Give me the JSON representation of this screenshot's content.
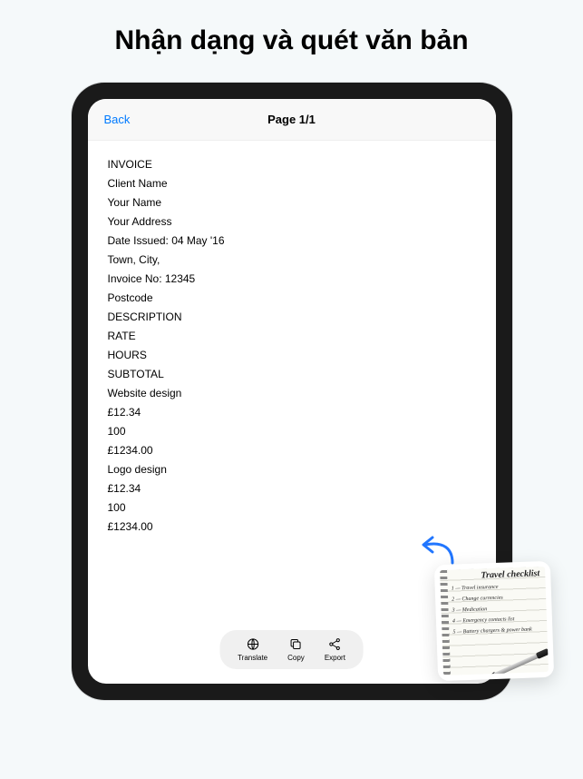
{
  "headline": "Nhận dạng và quét văn bản",
  "nav": {
    "back": "Back",
    "title": "Page 1/1"
  },
  "lines": [
    "INVOICE",
    "Client Name",
    "Your Name",
    "Your Address",
    "Date Issued: 04 May '16",
    "Town, City,",
    "Invoice No: 12345",
    "Postcode",
    "DESCRIPTION",
    "RATE",
    "HOURS",
    "SUBTOTAL",
    "Website design",
    "£12.34",
    "100",
    "£1234.00",
    "Logo design",
    "£12.34",
    "100",
    "£1234.00"
  ],
  "toolbar": {
    "translate": "Translate",
    "copy": "Copy",
    "export": "Export"
  },
  "note": {
    "title": "Travel checklist",
    "items": [
      "1 — Travel insurance",
      "2 — Change currencies",
      "3 — Medication",
      "4 — Emergency contacts list",
      "5 — Battery chargers & power bank"
    ]
  }
}
